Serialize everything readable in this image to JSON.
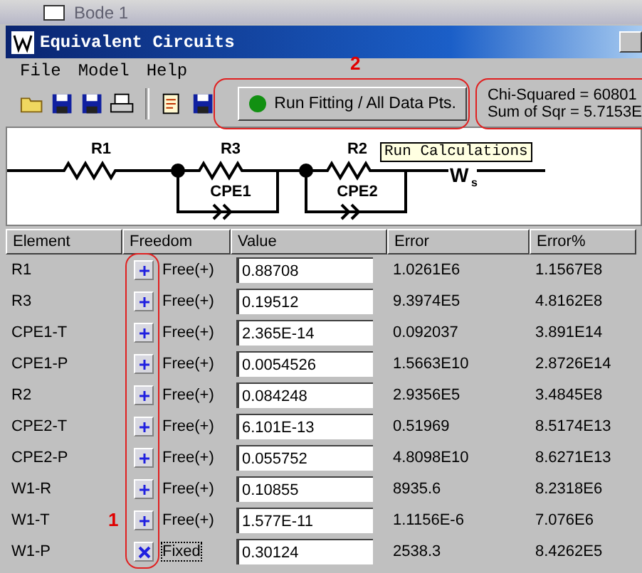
{
  "background_window": {
    "title": "Bode 1"
  },
  "window": {
    "title": "Equivalent Circuits"
  },
  "menu": [
    {
      "label": "File"
    },
    {
      "label": "Model"
    },
    {
      "label": "Help"
    }
  ],
  "toolbar": {
    "run_button": {
      "label": "Run Fitting / All Data Pts."
    },
    "stats": [
      "Chi-Squared = 60801",
      "Sum of Sqr = 5.7153E"
    ]
  },
  "circuit": {
    "labels": [
      "R1",
      "R3",
      "CPE1",
      "R2",
      "CPE2"
    ],
    "warburg": {
      "symbol": "W",
      "subscript": "s"
    },
    "tooltip": "Run Calculations"
  },
  "annotations": [
    "2",
    "1"
  ],
  "table": {
    "columns": [
      "Element",
      "Freedom",
      "Value",
      "Error",
      "Error%"
    ],
    "rows": [
      {
        "element": "R1",
        "freedom": "Free(+)",
        "fixed": false,
        "value": "0.88708",
        "error": "1.0261E6",
        "error_pct": "1.1567E8"
      },
      {
        "element": "R3",
        "freedom": "Free(+)",
        "fixed": false,
        "value": "0.19512",
        "error": "9.3974E5",
        "error_pct": "4.8162E8"
      },
      {
        "element": "CPE1-T",
        "freedom": "Free(+)",
        "fixed": false,
        "value": "2.365E-14",
        "error": "0.092037",
        "error_pct": "3.891E14"
      },
      {
        "element": "CPE1-P",
        "freedom": "Free(+)",
        "fixed": false,
        "value": "0.0054526",
        "error": "1.5663E10",
        "error_pct": "2.8726E14"
      },
      {
        "element": "R2",
        "freedom": "Free(+)",
        "fixed": false,
        "value": "0.084248",
        "error": "2.9356E5",
        "error_pct": "3.4845E8"
      },
      {
        "element": "CPE2-T",
        "freedom": "Free(+)",
        "fixed": false,
        "value": "6.101E-13",
        "error": "0.51969",
        "error_pct": "8.5174E13"
      },
      {
        "element": "CPE2-P",
        "freedom": "Free(+)",
        "fixed": false,
        "value": "0.055752",
        "error": "4.8098E10",
        "error_pct": "8.6271E13"
      },
      {
        "element": "W1-R",
        "freedom": "Free(+)",
        "fixed": false,
        "value": "0.10855",
        "error": "8935.6",
        "error_pct": "8.2318E6"
      },
      {
        "element": "W1-T",
        "freedom": "Free(+)",
        "fixed": false,
        "value": "1.577E-11",
        "error": "1.1156E-6",
        "error_pct": "7.076E6"
      },
      {
        "element": "W1-P",
        "freedom": "Fixed",
        "fixed": true,
        "value": "0.30124",
        "error": "2538.3",
        "error_pct": "8.4262E5"
      }
    ]
  }
}
